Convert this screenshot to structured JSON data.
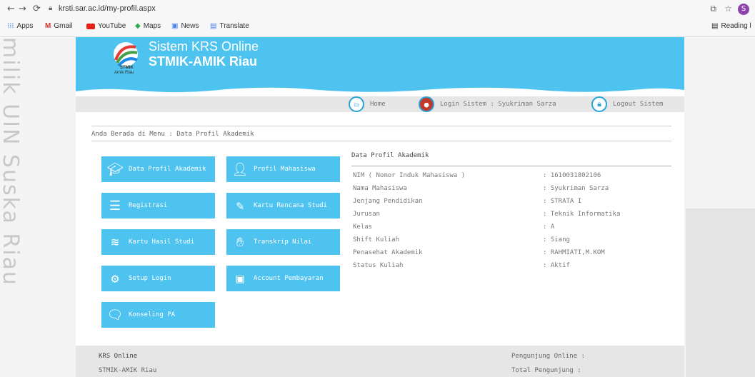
{
  "browser": {
    "url": "krsti.sar.ac.id/my-profil.aspx",
    "bookmarks": [
      "Apps",
      "Gmail",
      "YouTube",
      "Maps",
      "News",
      "Translate"
    ],
    "reading_list": "Reading l",
    "profile_initial": "S"
  },
  "watermark": "milik UIN Suska Riau",
  "header": {
    "title_line1": "Sistem KRS Online",
    "title_line2": "STMIK-AMIK Riau",
    "logo_text_1": "STMIK",
    "logo_text_2": "Amik Riau"
  },
  "topbar": {
    "home": "Home",
    "login": "Login Sistem : Syukriman Sarza",
    "logout": "Logout Sistem"
  },
  "breadcrumb": "Anda Berada di Menu : Data Profil Akademik",
  "menu": [
    {
      "label": "Data Profil Akademik",
      "icon": "graduate-icon"
    },
    {
      "label": "Profil Mahasiswa",
      "icon": "user-edit-icon"
    },
    {
      "label": "Registrasi",
      "icon": "registration-form-icon"
    },
    {
      "label": "Kartu Rencana Studi",
      "icon": "pen-sign-icon"
    },
    {
      "label": "Kartu Hasil Studi",
      "icon": "books-stack-icon"
    },
    {
      "label": "Transkrip Nilai",
      "icon": "handshake-icon"
    },
    {
      "label": "Setup Login",
      "icon": "gear-icon"
    },
    {
      "label": "Account Pembayaran",
      "icon": "briefcase-icon"
    },
    {
      "label": "Konseling PA",
      "icon": "chat-icon"
    }
  ],
  "profile": {
    "title": "Data Profil Akademik",
    "rows": [
      {
        "k": "NIM ( Nomor Induk Mahasiswa )",
        "v": ": 1610031802106"
      },
      {
        "k": "Nama Mahasiswa",
        "v": ": Syukriman Sarza"
      },
      {
        "k": "Jenjang Pendidikan",
        "v": ": STRATA I"
      },
      {
        "k": "Jurusan",
        "v": ": Teknik Informatika"
      },
      {
        "k": "Kelas",
        "v": ": A"
      },
      {
        "k": "Shift Kuliah",
        "v": ": Siang"
      },
      {
        "k": "Penasehat Akademik",
        "v": ": RAHMIATI,M.KOM"
      },
      {
        "k": "Status Kuliah",
        "v": ": Aktif"
      }
    ]
  },
  "footer": {
    "left1": "KRS Online",
    "left2": "STMIK-AMIK Riau",
    "right1": "Pengunjung Online :",
    "right2": "Total Pengunjung :"
  },
  "colors": {
    "accent": "#4fc3f0",
    "icon_border": "#29a3d6"
  }
}
